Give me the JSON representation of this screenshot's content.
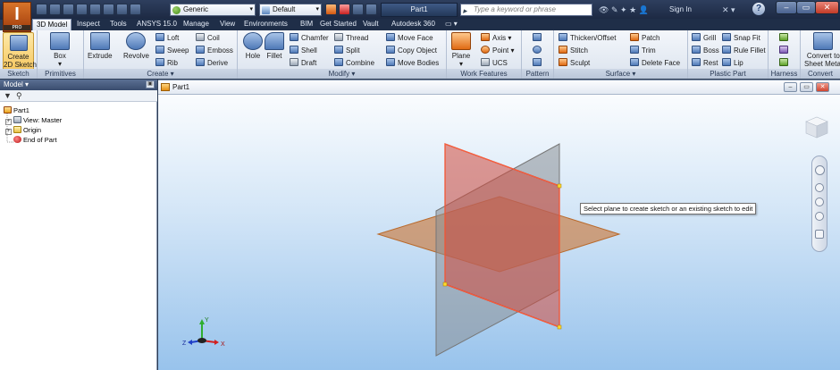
{
  "title_bar": {
    "logo_letter": "I",
    "logo_sub": "PRO",
    "material": "Generic",
    "appearance": "Default",
    "document": "Part1",
    "search_placeholder": "Type a keyword or phrase",
    "sign_in": "Sign In",
    "help": "?",
    "win_min": "–",
    "win_max": "▭",
    "win_close": "✕"
  },
  "tabs": [
    {
      "label": "3D Model",
      "active": true
    },
    {
      "label": "Inspect"
    },
    {
      "label": "Tools"
    },
    {
      "label": "ANSYS 15.0"
    },
    {
      "label": "Manage"
    },
    {
      "label": "View"
    },
    {
      "label": "Environments"
    },
    {
      "label": "BIM"
    },
    {
      "label": "Get Started"
    },
    {
      "label": "Vault"
    },
    {
      "label": "Autodesk 360"
    },
    {
      "label": "▭ ▾"
    }
  ],
  "ribbon": {
    "sketch": {
      "title": "Sketch",
      "create": "Create",
      "create2": "2D Sketch"
    },
    "primitives": {
      "title": "Primitives",
      "box": "Box"
    },
    "create": {
      "title": "Create ▾",
      "extrude": "Extrude",
      "revolve": "Revolve",
      "loft": "Loft",
      "sweep": "Sweep",
      "rib": "Rib",
      "coil": "Coil",
      "emboss": "Emboss",
      "derive": "Derive"
    },
    "modify": {
      "title": "Modify ▾",
      "hole": "Hole",
      "fillet": "Fillet",
      "chamfer": "Chamfer",
      "shell": "Shell",
      "draft": "Draft",
      "thread": "Thread",
      "split": "Split",
      "combine": "Combine",
      "move_face": "Move Face",
      "copy_object": "Copy Object",
      "move_bodies": "Move Bodies"
    },
    "work_features": {
      "title": "Work Features",
      "plane": "Plane",
      "axis": "Axis ▾",
      "point": "Point ▾",
      "ucs": "UCS"
    },
    "pattern": {
      "title": "Pattern"
    },
    "surface": {
      "title": "Surface ▾",
      "thicken": "Thicken/Offset",
      "stitch": "Stitch",
      "sculpt": "Sculpt",
      "patch": "Patch",
      "trim": "Trim",
      "delete_face": "Delete Face"
    },
    "plastic_part": {
      "title": "Plastic Part",
      "grill": "Grill",
      "boss": "Boss",
      "rest": "Rest",
      "snap_fit": "Snap Fit",
      "rule_fillet": "Rule Fillet",
      "lip": "Lip"
    },
    "harness": {
      "title": "Harness"
    },
    "convert": {
      "title": "Convert",
      "convert1": "Convert to",
      "convert2": "Sheet Metal"
    }
  },
  "browser": {
    "header": "Model ▾",
    "tree": [
      "Part1",
      "View: Master",
      "Origin",
      "End of Part"
    ]
  },
  "viewport": {
    "title": "Part1",
    "tooltip": "Select plane to create sketch or an existing sketch to edit",
    "axes": {
      "y": "Y",
      "z": "Z",
      "x": "X"
    }
  }
}
